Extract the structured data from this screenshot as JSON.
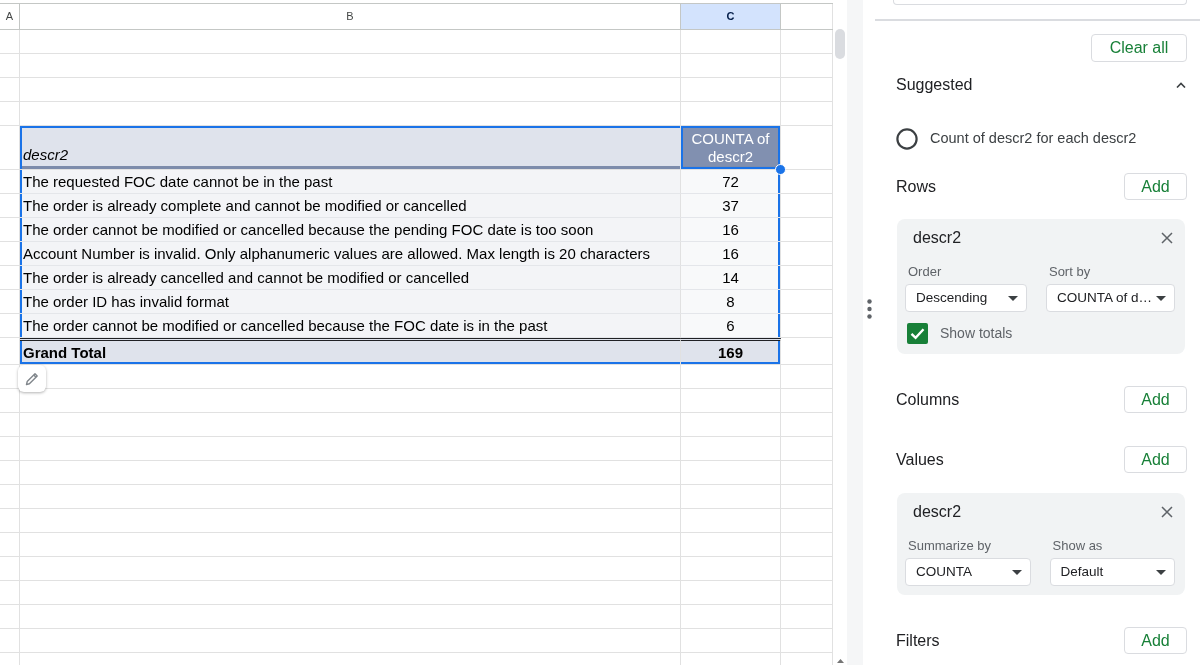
{
  "sheet": {
    "columns": [
      {
        "label": "A",
        "selected": false
      },
      {
        "label": "B",
        "selected": false
      },
      {
        "label": "C",
        "selected": true
      }
    ],
    "pivot_table": {
      "header": [
        {
          "label": "descr2",
          "selected": false
        },
        {
          "label": "COUNTA of descr2",
          "selected": true
        }
      ],
      "rows": [
        {
          "label": "The requested FOC date cannot be in the past",
          "value": "72"
        },
        {
          "label": "The order is already complete and cannot be modified or cancelled",
          "value": "37"
        },
        {
          "label": "The order cannot be modified or cancelled because the pending FOC date is too soon",
          "value": "16"
        },
        {
          "label": "Account Number is invalid. Only alphanumeric values are allowed. Max length is 20 characters",
          "value": "16"
        },
        {
          "label": "The order is already cancelled and cannot be modified or cancelled",
          "value": "14"
        },
        {
          "label": "The order ID has invalid format",
          "value": "8"
        },
        {
          "label": "The order cannot be modified or cancelled because the FOC date is in the past",
          "value": "6"
        }
      ],
      "total": {
        "label": "Grand Total",
        "value": "169"
      }
    }
  },
  "editor": {
    "clear_button": "Clear all",
    "suggested": {
      "title": "Suggested",
      "expanded": true,
      "items": [
        {
          "label": "Count of descr2 for each descr2",
          "selected": false
        }
      ]
    },
    "sections": [
      {
        "title": "Rows",
        "add_button": "Add",
        "fields": [
          {
            "name": "descr2",
            "settings": [
              {
                "label": "Order",
                "value": "Descending"
              },
              {
                "label": "Sort by",
                "value": "COUNTA of d…"
              }
            ],
            "show_totals": {
              "label": "Show totals",
              "checked": true
            }
          }
        ]
      },
      {
        "title": "Columns",
        "add_button": "Add"
      },
      {
        "title": "Values",
        "add_button": "Add",
        "fields": [
          {
            "name": "descr2",
            "settings": [
              {
                "label": "Summarize by",
                "value": "COUNTA"
              },
              {
                "label": "Show as",
                "value": "Default"
              }
            ]
          }
        ]
      },
      {
        "title": "Filters",
        "add_button": "Add"
      }
    ]
  }
}
